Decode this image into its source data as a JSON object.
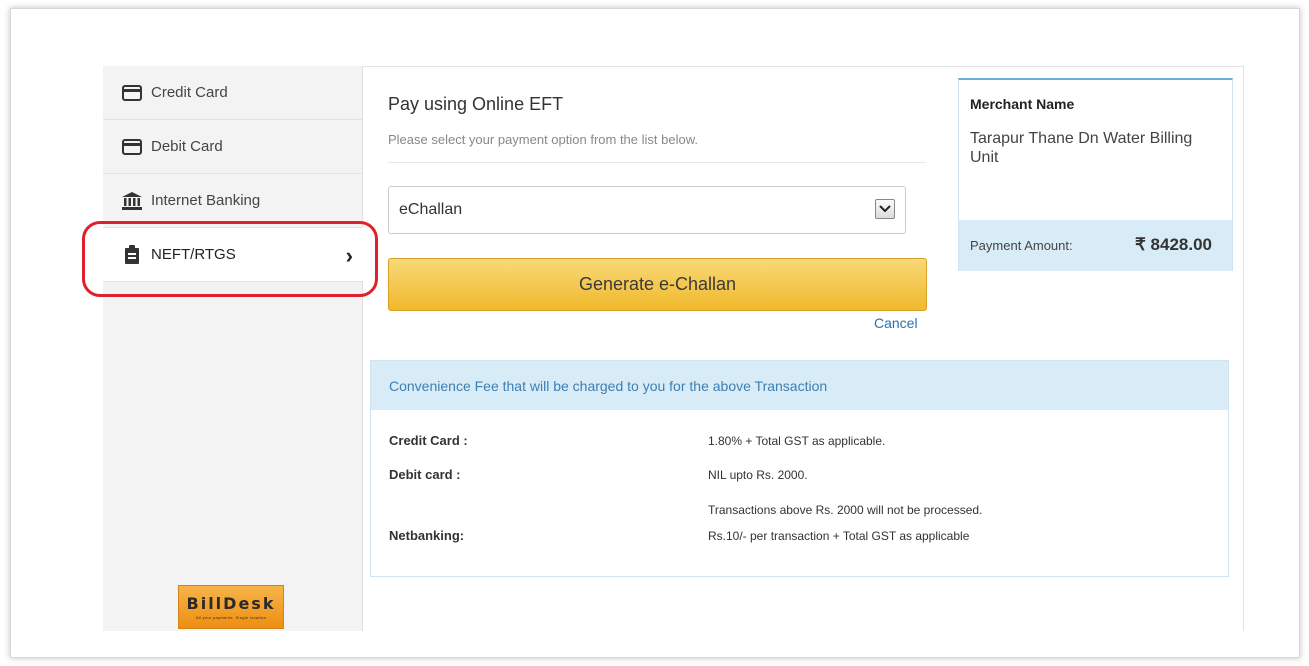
{
  "sidebar": {
    "items": [
      {
        "label": "Credit Card",
        "icon": "credit-card-icon"
      },
      {
        "label": "Debit Card",
        "icon": "debit-card-icon"
      },
      {
        "label": "Internet Banking",
        "icon": "bank-icon"
      },
      {
        "label": "NEFT/RTGS",
        "icon": "clipboard-icon",
        "active": true
      }
    ],
    "logo": {
      "text": "BillDesk",
      "tagline": "All your payments. Single location"
    }
  },
  "main": {
    "title": "Pay using Online EFT",
    "subtitle": "Please select your payment option from the list below.",
    "select_value": "eChallan",
    "generate_label": "Generate e-Challan",
    "cancel_label": "Cancel"
  },
  "merchant": {
    "label": "Merchant Name",
    "name": "Tarapur Thane Dn Water Billing Unit",
    "amount_label": "Payment Amount:",
    "amount_value": "₹ 8428.00"
  },
  "fees": {
    "heading": "Convenience Fee that will be charged to you for the above Transaction",
    "rows": [
      {
        "label": "Credit Card :",
        "value": "1.80% + Total GST as applicable."
      },
      {
        "label": "Debit card :",
        "value": "NIL upto Rs. 2000."
      },
      {
        "label": "",
        "value": "Transactions above Rs. 2000 will not be processed."
      },
      {
        "label": "Netbanking:",
        "value": "Rs.10/- per transaction + Total GST as applicable"
      }
    ]
  },
  "colors": {
    "accent_blue": "#3d7fb3",
    "button_yellow": "#f0b82c",
    "highlight_red": "#e0202a",
    "info_bg": "#d7ecf7"
  }
}
